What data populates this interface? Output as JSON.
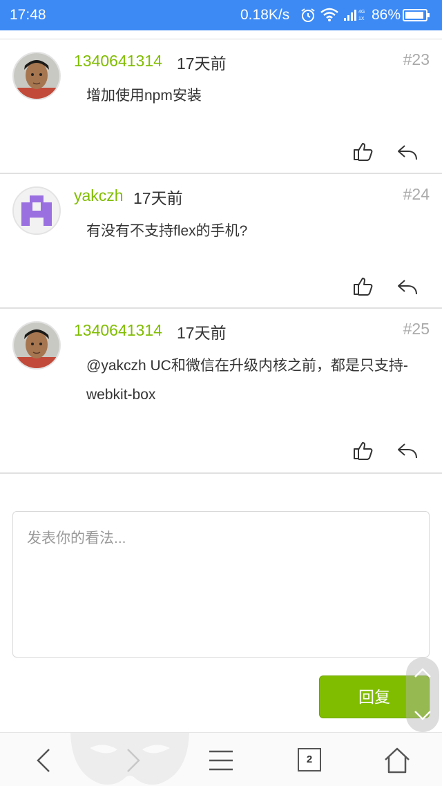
{
  "status_bar": {
    "time": "17:48",
    "speed": "0.18K/s",
    "battery": "86%"
  },
  "comments": [
    {
      "author": "1340641314",
      "time": "17天前",
      "floor": "#23",
      "content": "增加使用npm安装",
      "avatar": "boy-photo"
    },
    {
      "author": "yakczh",
      "time": "17天前",
      "floor": "#24",
      "content": "有没有不支持flex的手机?",
      "avatar": "purple-identicon"
    },
    {
      "author": "1340641314",
      "time": "17天前",
      "floor": "#25",
      "content": "@yakczh UC和微信在升级内核之前，都是只支持-webkit-box",
      "avatar": "boy-photo"
    }
  ],
  "reply": {
    "placeholder": "发表你的看法...",
    "button_label": "回复"
  },
  "bottom_bar": {
    "tab_count": "2"
  },
  "colors": {
    "status_bar": "#3d8af5",
    "author": "#80bd01",
    "button": "#80bd01",
    "identicon": "#9a6fe0"
  }
}
